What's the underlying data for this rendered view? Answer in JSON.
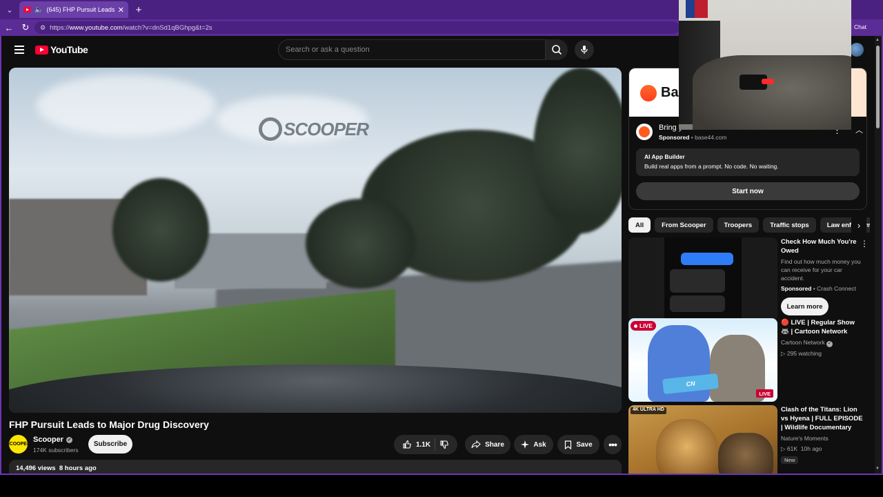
{
  "browser": {
    "tab_title": "(645) FHP Pursuit Leads to Major Drug Discovery - YouTube",
    "tab_title_visible": "(645) FHP Pursuit Leads to M",
    "url_prefix": "https://",
    "url_host": "www.youtube.com",
    "url_path": "/watch?v=dnSd1qBGhpg&t=2s",
    "chat_label": "Chat",
    "accent": "#4a2180"
  },
  "header": {
    "logo_text": "YouTube",
    "search_placeholder": "Search or ask a question"
  },
  "video": {
    "title": "FHP Pursuit Leads to Major Drug Discovery",
    "channel": "Scooper",
    "channel_avatar_text": "SCOOPER",
    "subscribers": "174K subscribers",
    "subscribe_label": "Subscribe",
    "likes": "1.1K",
    "share_label": "Share",
    "ask_label": "Ask",
    "save_label": "Save",
    "views_time": "14,496 views  8 hours ago",
    "watermark": "SCOOPER"
  },
  "ad": {
    "banner_text": "Ba",
    "title": "Bring your leads to life",
    "sponsored": "Sponsored",
    "domain": "base44.com",
    "desc_title": "AI App Builder",
    "desc_text": "Build real apps from a prompt. No code. No waiting.",
    "cta": "Start now"
  },
  "chips": [
    "All",
    "From Scooper",
    "Troopers",
    "Traffic stops",
    "Law enforcement"
  ],
  "recommendations": [
    {
      "title": "Check How Much You're Owed",
      "desc": "Find out how much money you can receive for your car accident.",
      "sponsored": "Sponsored",
      "advertiser": "Crash Connect",
      "cta": "Learn more"
    },
    {
      "title": "🔴 LIVE | Regular Show 🦝 | Cartoon Network",
      "channel": "Cartoon Network",
      "meta": "295 watching",
      "badge": "LIVE",
      "badge2": "LIVE"
    },
    {
      "title": "Clash of the Titans: Lion vs Hyena | FULL EPISODE | Wildlife Documentary",
      "channel": "Nature's Moments",
      "meta": "61K  10h ago",
      "badge": "4K ULTRA HD",
      "new": "New"
    }
  ]
}
